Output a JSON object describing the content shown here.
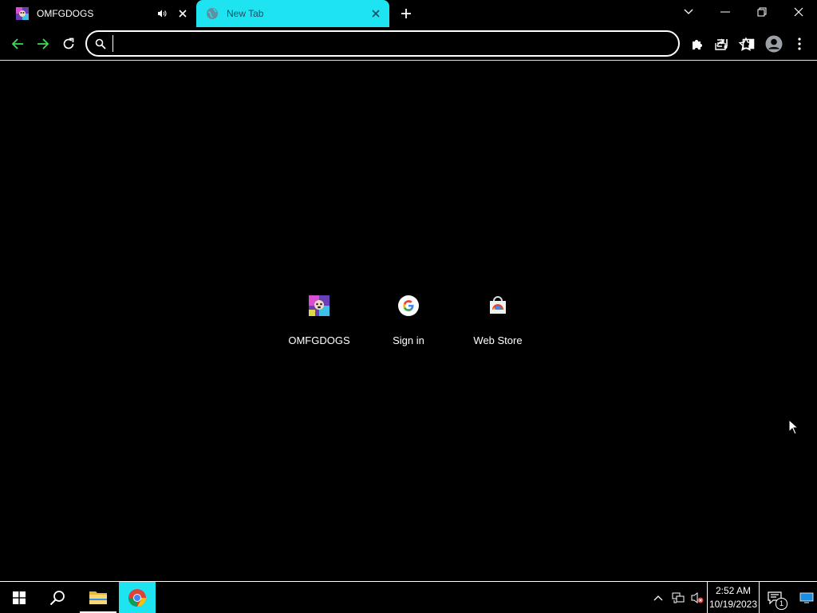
{
  "browser": {
    "tabs": [
      {
        "title": "OMFGDOGS",
        "favicon": "omfgdogs-icon",
        "audio": "speaker-playing-icon",
        "active": false
      },
      {
        "title": "New Tab",
        "favicon": "globe-icon",
        "active": true
      }
    ],
    "address_bar": {
      "value": "",
      "placeholder": ""
    },
    "accent_color": "#1ee3f0"
  },
  "new_tab_page": {
    "shortcuts": [
      {
        "label": "OMFGDOGS",
        "icon": "omfgdogs-icon"
      },
      {
        "label": "Sign in",
        "icon": "google-icon"
      },
      {
        "label": "Web Store",
        "icon": "web-store-icon"
      }
    ]
  },
  "taskbar": {
    "pinned": [
      "windows-start-icon",
      "search-icon",
      "file-explorer-icon",
      "chrome-icon"
    ],
    "clock": {
      "time": "2:52 AM",
      "date": "10/19/2023"
    },
    "notification_count": "1"
  }
}
